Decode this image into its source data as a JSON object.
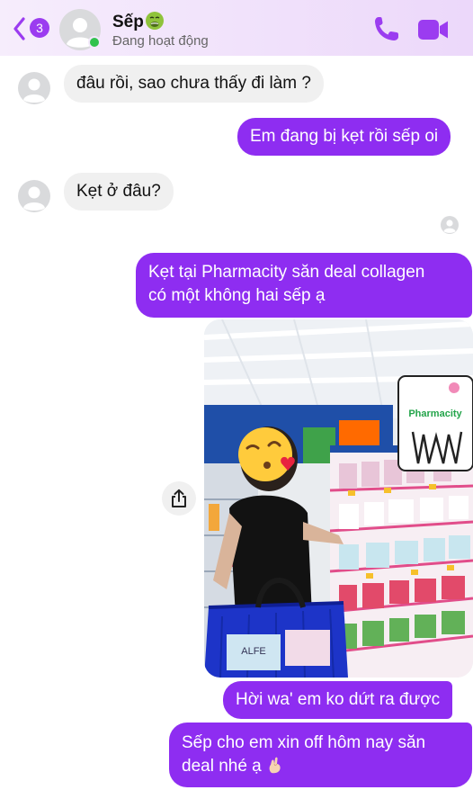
{
  "header": {
    "back_badge": "3",
    "contact_name": "Sếp",
    "contact_emoji": "nauseated-face",
    "status": "Đang hoạt động",
    "accent_color": "#9b3cf0"
  },
  "messages": [
    {
      "side": "in",
      "text": "đâu rồi, sao chưa thấy đi làm ?"
    },
    {
      "side": "out",
      "text": "Em đang bị kẹt rồi sếp oi"
    },
    {
      "side": "in",
      "text": "Kẹt ở đâu?"
    },
    {
      "side": "out",
      "lines": [
        "Kẹt tại Pharmacity săn deal collagen",
        "có một không hai sếp ạ"
      ]
    },
    {
      "side": "out",
      "type": "photo",
      "photo_sign_text": "Pharmacity",
      "basket_box_text": "ALFE"
    },
    {
      "side": "out",
      "text": "Hời wa' em ko dứt ra được"
    },
    {
      "side": "out",
      "lines": [
        "Sếp cho em xin off hôm nay săn",
        "deal nhé ạ"
      ],
      "trailing_emoji": "pinching-hand"
    }
  ],
  "colors": {
    "outgoing_bubble": "#8e2df1",
    "incoming_bubble": "#f0f0f0",
    "online": "#31c24d"
  }
}
